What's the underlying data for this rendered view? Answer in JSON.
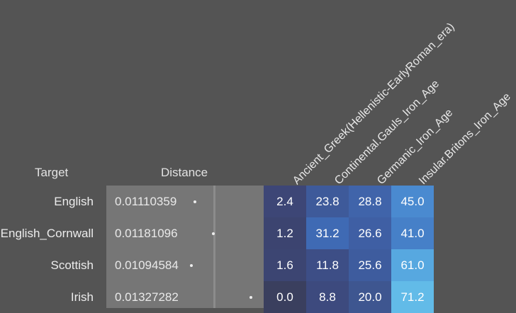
{
  "headers": {
    "target": "Target",
    "distance": "Distance"
  },
  "columns": [
    "Ancient_Greek(Hellenistic-EarlyRoman_era)",
    "Continental.Gauls_Iron_Age",
    "Germanic_Iron_Age",
    "Insular.Britons_Iron_Age"
  ],
  "rows": [
    {
      "target": "English",
      "distance": "0.01110359",
      "values": [
        "2.4",
        "23.8",
        "28.8",
        "45.0"
      ]
    },
    {
      "target": "English_Cornwall",
      "distance": "0.01181096",
      "values": [
        "1.2",
        "31.2",
        "26.6",
        "41.0"
      ]
    },
    {
      "target": "Scottish",
      "distance": "0.01094584",
      "values": [
        "1.6",
        "11.8",
        "25.6",
        "61.0"
      ]
    },
    {
      "target": "Irish",
      "distance": "0.01327282",
      "values": [
        "0.0",
        "8.8",
        "20.0",
        "71.2"
      ]
    }
  ],
  "colors": {
    "background": "#545454",
    "distance_bar": "#767676",
    "heatmap_low": "#3a4268",
    "heatmap_high": "#5fb8e6"
  }
}
